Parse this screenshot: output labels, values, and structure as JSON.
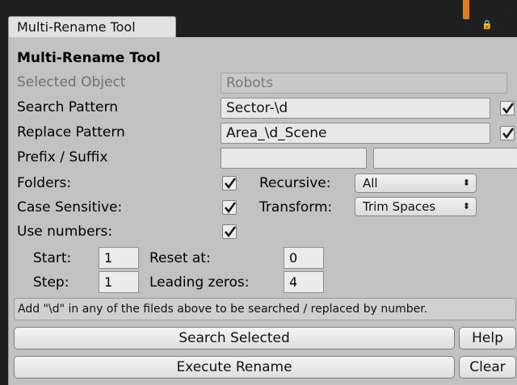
{
  "window": {
    "tab_title": "Multi-Rename Tool",
    "tools": {
      "plus": "+",
      "lock": "🔒",
      "menu": "▾≡",
      "maximize": "▫",
      "close": "×"
    },
    "accent": "#e07d1a"
  },
  "panel": {
    "heading": "Multi-Rename Tool",
    "selected_object": {
      "label": "Selected Object",
      "value": "Robots"
    },
    "search_pattern": {
      "label": "Search Pattern",
      "value": "Sector-\\d",
      "enabled": true
    },
    "replace_pattern": {
      "label": "Replace Pattern",
      "value": "Area_\\d_Scene",
      "enabled": true
    },
    "prefix_suffix": {
      "label": "Prefix / Suffix",
      "prefix": "",
      "suffix": ""
    },
    "folders": {
      "label": "Folders:",
      "checked": true
    },
    "recursive": {
      "label": "Recursive:",
      "value": "All"
    },
    "case_sensitive": {
      "label": "Case Sensitive:",
      "checked": true
    },
    "transform": {
      "label": "Transform:",
      "value": "Trim Spaces"
    },
    "use_numbers": {
      "label": "Use numbers:",
      "checked": true
    },
    "start": {
      "label": "Start:",
      "value": "1"
    },
    "reset_at": {
      "label": "Reset at:",
      "value": "0"
    },
    "step": {
      "label": "Step:",
      "value": "1"
    },
    "leading_zeros": {
      "label": "Leading zeros:",
      "value": "4"
    },
    "hint": "Add \"\\d\" in any of the fileds above to be searched / replaced by number.",
    "buttons": {
      "search_selected": "Search Selected",
      "help": "Help",
      "execute_rename": "Execute Rename",
      "clear": "Clear"
    }
  }
}
